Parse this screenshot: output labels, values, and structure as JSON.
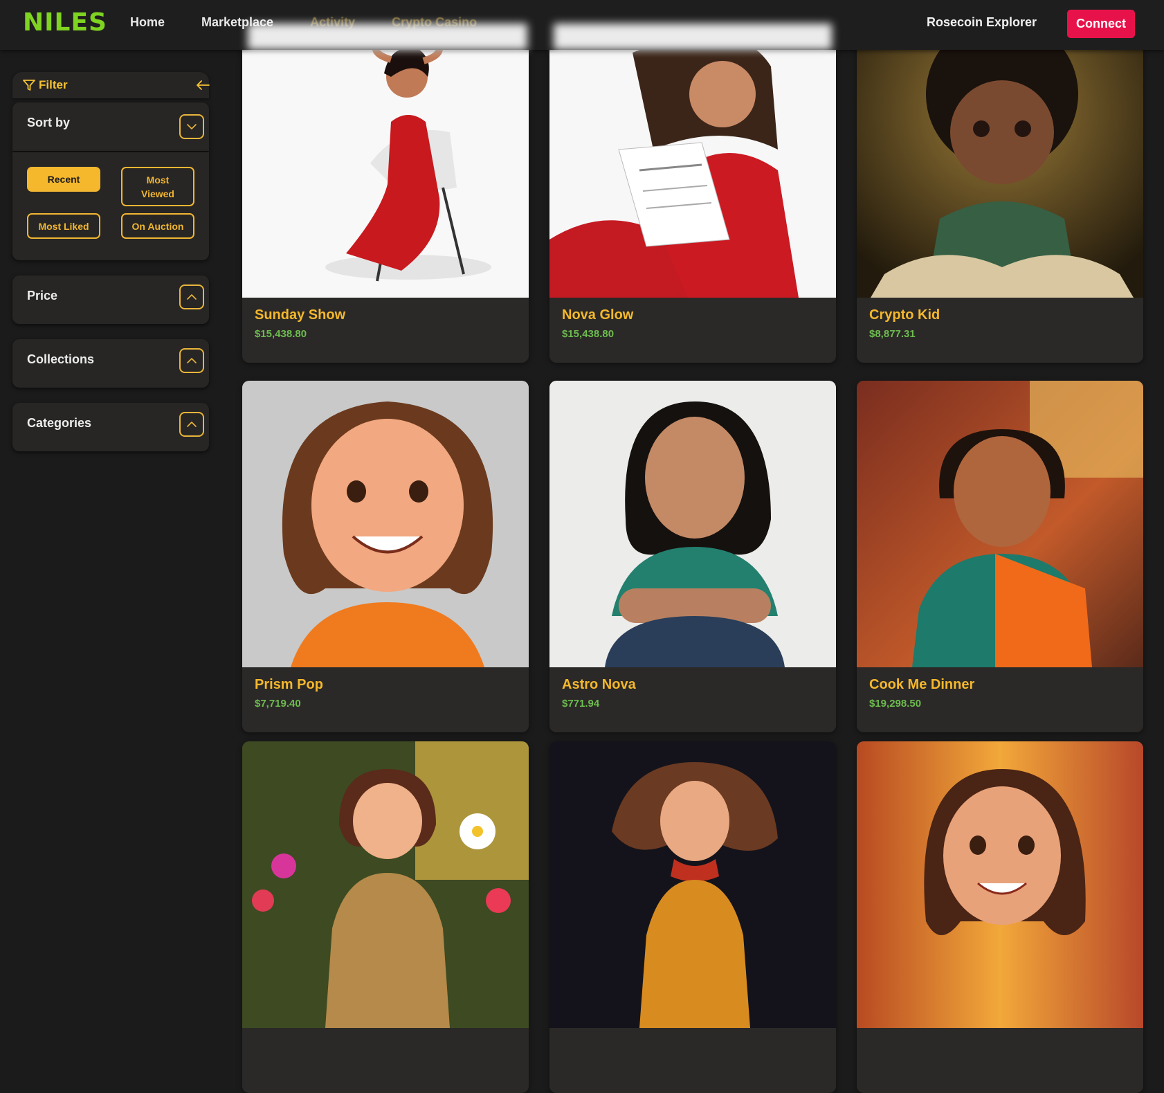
{
  "header": {
    "logo": "NILES",
    "nav": [
      "Home",
      "Marketplace",
      "Activity",
      "Crypto Casino"
    ],
    "explorer_link": "Rosecoin Explorer",
    "connect_label": "Connect"
  },
  "sidebar": {
    "filter_label": "Filter",
    "sort": {
      "title": "Sort by",
      "options": [
        "Recent",
        "Most Viewed",
        "Most Liked",
        "On Auction"
      ],
      "selected": "Recent"
    },
    "panels": [
      "Price",
      "Collections",
      "Categories"
    ]
  },
  "cards": [
    {
      "title": "Sunday Show",
      "price": "$15,438.80"
    },
    {
      "title": "Nova Glow",
      "price": "$15,438.80"
    },
    {
      "title": "Crypto Kid",
      "price": "$8,877.31"
    },
    {
      "title": "Prism Pop",
      "price": "$7,719.40"
    },
    {
      "title": "Astro Nova",
      "price": "$771.94"
    },
    {
      "title": "Cook Me Dinner",
      "price": "$19,298.50"
    },
    {
      "title": "",
      "price": ""
    },
    {
      "title": "",
      "price": ""
    },
    {
      "title": "",
      "price": ""
    }
  ],
  "colors": {
    "accent": "#f5b82c",
    "logo": "#7fd321",
    "connect": "#e8124a",
    "price": "#6dbb4f",
    "background": "#1b1b1b"
  },
  "icons": {
    "filter": "funnel-icon",
    "back": "arrow-left-icon",
    "sort_toggle": "chevron-down-icon",
    "panel_toggle": "chevron-up-icon"
  }
}
